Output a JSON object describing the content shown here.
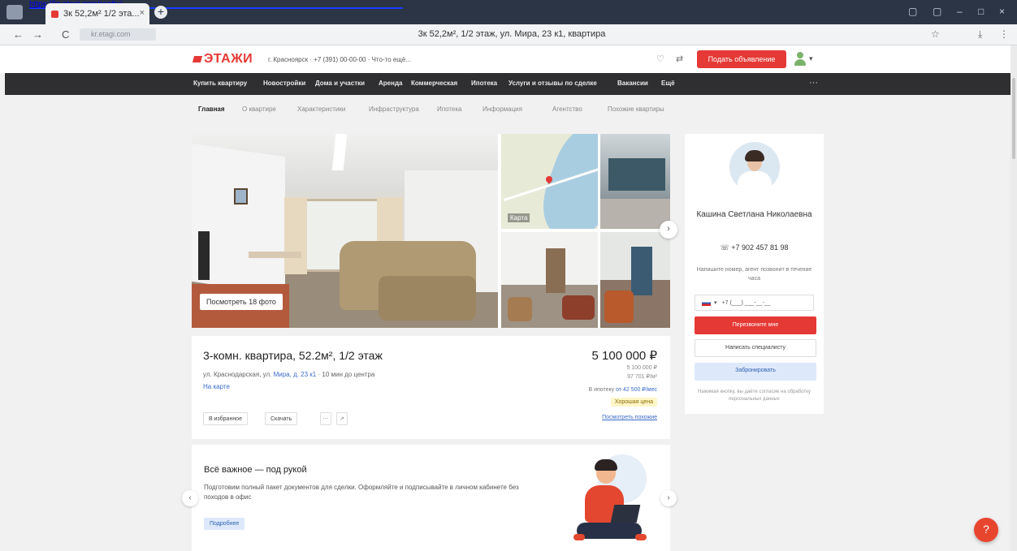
{
  "browser": {
    "tab_title": "3к 52,2м² 1/2 эта...",
    "tab_close": "×",
    "new_tab": "+",
    "tab_link": "https://kr.etagi.com/realty/...",
    "back": "←",
    "forward": "→",
    "reload": "C",
    "url": "kr.etagi.com",
    "page_title": "3к 52,2м², 1/2 этаж, ул. Мира, 23 к1, квартира",
    "menu_icon": "⋮"
  },
  "header": {
    "logo": "ЭТАЖИ",
    "city": "г. Красноярск · +7 (391) 00-00-00 · Что-то ещё...",
    "post_button": "Подать объявление",
    "heart": "♡",
    "compare": "⇄"
  },
  "menu": {
    "items": [
      "Купить квартиру",
      "Новостройки",
      "Дома и участки",
      "Аренда",
      "Коммерческая",
      "Ипотека",
      "Услуги и отзывы по сделке",
      "Вакансии",
      "Ещё"
    ],
    "more": "···"
  },
  "subtabs": [
    "Главная",
    "О квартире",
    "Характеристики",
    "Инфраструктура",
    "Ипотека",
    "Информация",
    "Агентство",
    "Похожие квартиры"
  ],
  "gallery": {
    "show_photos": "Посмотреть 18 фото",
    "map_label": "Карта",
    "next": "›"
  },
  "listing": {
    "title": "3-комн. квартира, 52.2м², 1/2 этаж",
    "address_prefix": "ул. Краснодарская, ул. ",
    "address_link": "Мира, д. 23 к1",
    "address_suffix": " · 10 мин до центра",
    "nav_link": "На карте",
    "price": "5 100 000 ₽",
    "price_per_m": "97 701 ₽/м²",
    "price_note": "5 100 000 ₽",
    "mortgage_prefix": "В ипотеку ",
    "mortgage_link": "от 42 500 ₽/мес",
    "badge": "Хорошая цена",
    "compare_link": "Посмотреть похожие",
    "actions": [
      "В избранное",
      "Скачать"
    ],
    "icon_buttons": [
      "⋯",
      "↗"
    ]
  },
  "promo": {
    "title": "Всё важное — под рукой",
    "text": "Подготовим полный пакет документов для сделки. Оформляйте и подписывайте в личном кабинете без походов в офис",
    "button": "Подробнее",
    "prev": "‹",
    "next": "›"
  },
  "agent": {
    "name": "Кашина Светлана Николаевна",
    "phone": "☏ +7 902 457 81 98",
    "hint": "Напишите номер, агент позвонит в течение часа",
    "tel_placeholder": "+7 (___) ___-__-__",
    "tel_caret": "▾",
    "call_button": "Перезвоните мне",
    "ask_button": "Написать специалисту",
    "chat_button": "Забронировать",
    "legal": "Нажимая кнопку, вы даёте согласие на обработку персональных данных"
  },
  "chat": "?",
  "colors": {
    "brand_red": "#e53935",
    "menu_dark": "#2f2f31",
    "link_blue": "#3b6bc8"
  }
}
